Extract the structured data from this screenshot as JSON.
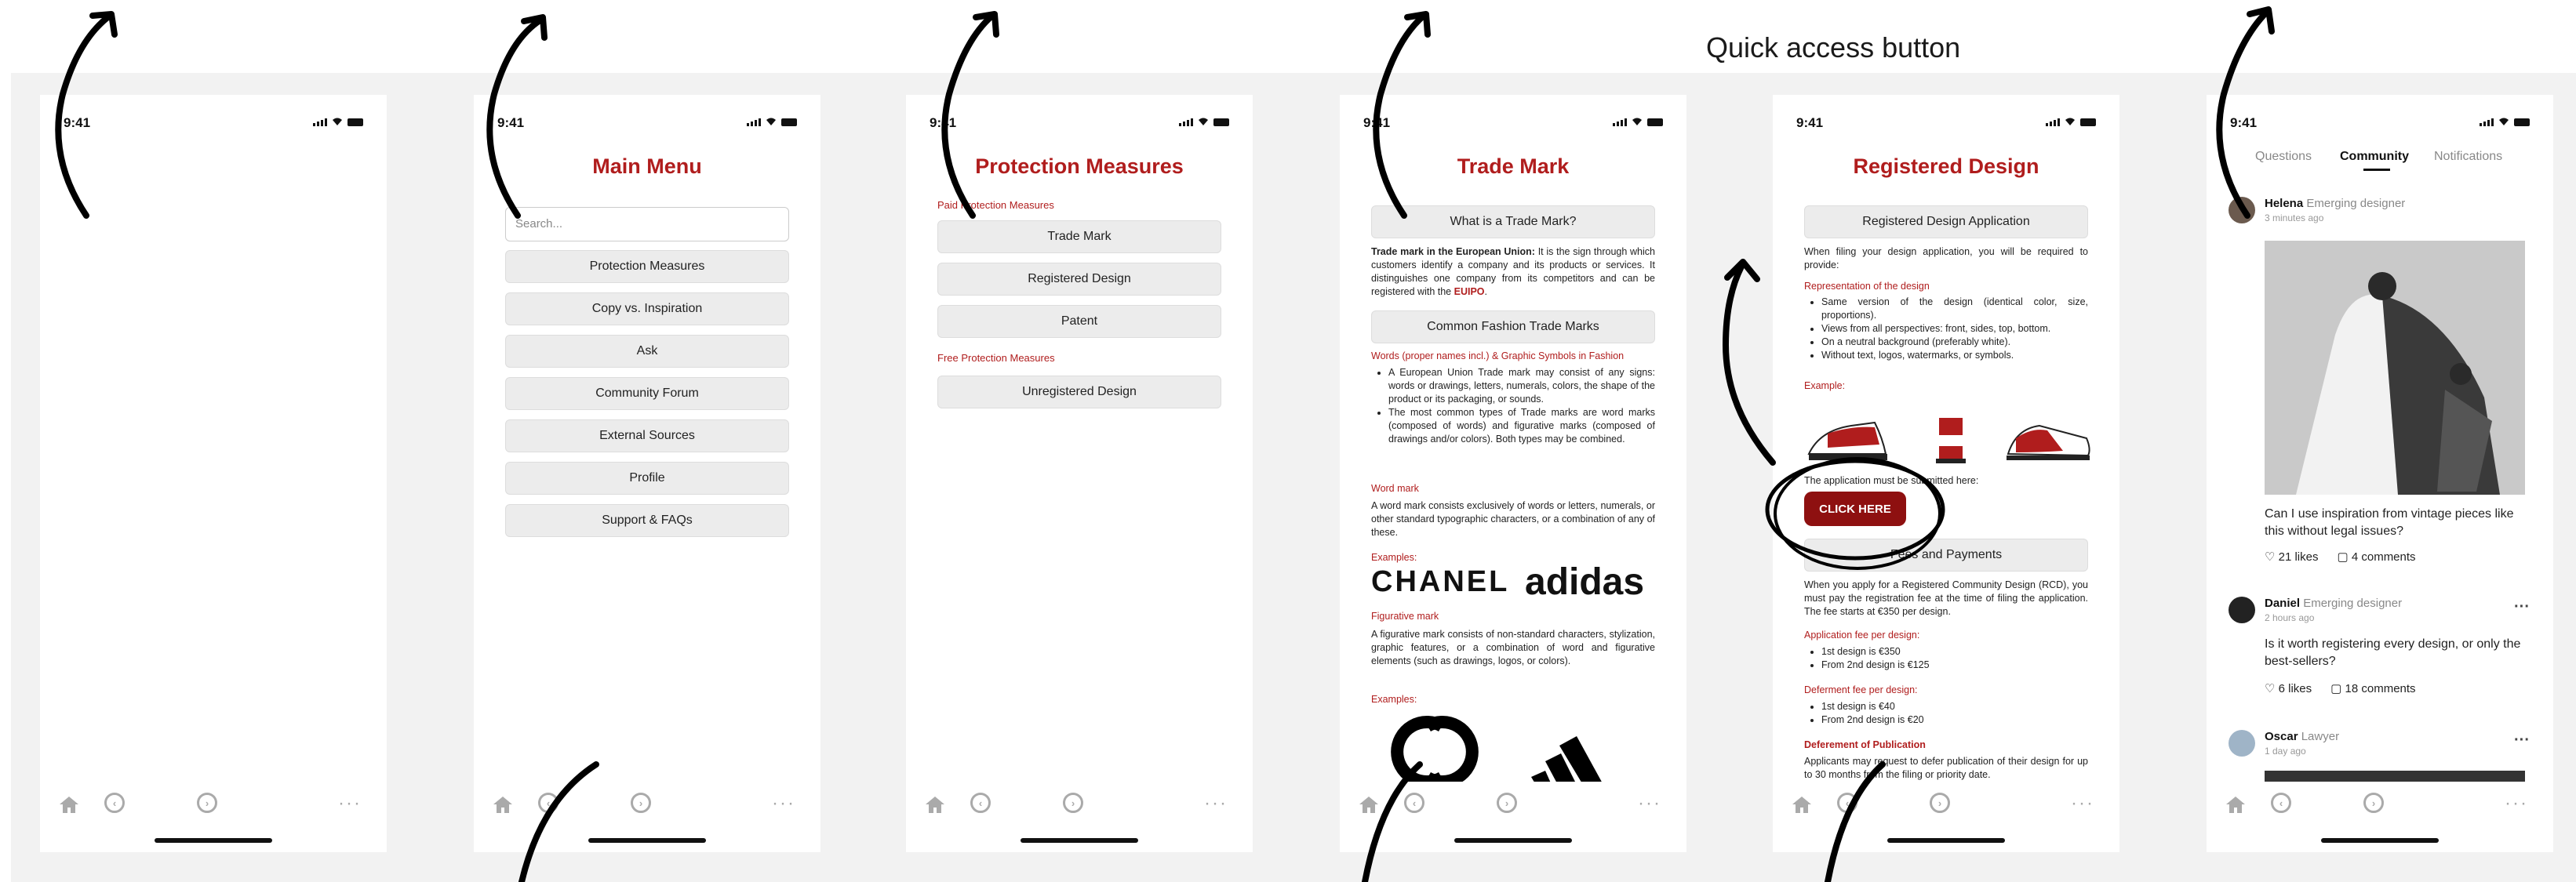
{
  "annotation": {
    "quick_access_label": "Quick access button"
  },
  "status": {
    "time": "9:41"
  },
  "screens": {
    "blank": {},
    "main_menu": {
      "title": "Main Menu",
      "search_placeholder": "Search...",
      "items": [
        "Protection Measures",
        "Copy vs. Inspiration",
        "Ask",
        "Community Forum",
        "External Sources",
        "Profile",
        "Support & FAQs"
      ]
    },
    "protection": {
      "title": "Protection Measures",
      "paid_label": "Paid Protection Measures",
      "paid_items": [
        "Trade Mark",
        "Registered Design",
        "Patent"
      ],
      "free_label": "Free Protection Measures",
      "free_items": [
        "Unregistered Design"
      ]
    },
    "trademark": {
      "title": "Trade Mark",
      "btn1": "What is a Trade Mark?",
      "intro_bold": "Trade mark in the European Union:",
      "intro_text": " It is the sign through which customers identify a company and its products or services. It distinguishes one company from its competitors and can be registered with the ",
      "euipo": "EUIPO",
      "btn2": "Common Fashion Trade Marks",
      "words_label": "Words (proper names incl.) & Graphic Symbols in Fashion",
      "bullets": [
        "A European Union Trade mark may consist of any signs: words or drawings, letters, numerals, colors, the shape of the product or its packaging, or sounds.",
        "The most common types of Trade marks are word marks (composed of words) and figurative marks (composed of drawings and/or colors). Both types may be combined."
      ],
      "word_mark_label": "Word mark",
      "word_mark_text": "A word mark consists exclusively of words or letters, numerals, or other standard typographic characters, or a combination of any of these.",
      "examples_label": "Examples:",
      "logo1": "CHANEL",
      "logo2": "adidas",
      "fig_label": "Figurative mark",
      "fig_text": "A figurative mark consists of non-standard characters, stylization, graphic features, or a combination of word and figurative elements (such as drawings, logos, or colors).",
      "examples_label2": "Examples:"
    },
    "registered": {
      "title": "Registered Design",
      "btn1": "Registered Design Application",
      "intro": "When filing your design application, you will be required to provide:",
      "rep_label": "Representation of the design",
      "bullets": [
        "Same version of the design (identical color, size, proportions).",
        "Views from all perspectives: front, sides, top, bottom.",
        "On a neutral background (preferably white).",
        "Without text, logos, watermarks, or symbols."
      ],
      "example_label": "Example:",
      "submit_text": "The application must be submitted here:",
      "click_here": "CLICK HERE",
      "btn2": "Fees and Payments",
      "fees_text": "When you apply for a Registered Community Design (RCD), you must pay the registration fee at the time of filing the application. The fee starts at €350 per design.",
      "app_fee_label": "Application fee per design:",
      "app_fees": [
        "1st design is €350",
        "From 2nd design is €125"
      ],
      "def_fee_label": "Deferment fee per design:",
      "def_fees": [
        "1st design is €40",
        "From 2nd design is €20"
      ],
      "deferment_label": "Deferement of Publication",
      "deferment_text": "Applicants may request to defer publication of their design for up to 30 months from the filing or priority date."
    },
    "community": {
      "tabs": [
        "Questions",
        "Community",
        "Notifications"
      ],
      "posts": [
        {
          "name": "Helena",
          "role": "Emerging designer",
          "time": "3 minutes ago",
          "question": "Can I use inspiration from vintage pieces like this without legal issues?",
          "likes": "21 likes",
          "comments": "4 comments"
        },
        {
          "name": "Daniel",
          "role": "Emerging designer",
          "time": "2 hours ago",
          "question": "Is it worth registering every design, or only the best-sellers?",
          "likes": "6 likes",
          "comments": "18 comments"
        },
        {
          "name": "Oscar",
          "role": "Lawyer",
          "time": "1 day ago"
        }
      ],
      "more": "···"
    }
  },
  "tabbar": {
    "more": "···"
  }
}
